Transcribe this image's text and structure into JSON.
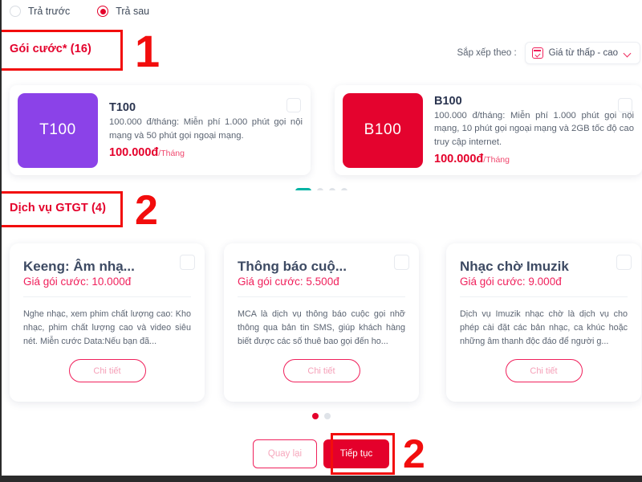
{
  "payment_type": {
    "options": [
      {
        "label": "Trả trước",
        "selected": false
      },
      {
        "label": "Trả sau",
        "selected": true
      }
    ]
  },
  "sections": {
    "plans_title": "Gói cước* (16)",
    "services_title": "Dịch vụ GTGT (4)"
  },
  "sort": {
    "label": "Sắp xếp theo :",
    "value": "Giá từ thấp - cao",
    "icon": "sort-price-icon",
    "chevron": "chevron-down-icon"
  },
  "plans": [
    {
      "tile_text": "T100",
      "tile_color": "#8b42e8",
      "name": "T100",
      "desc": "100.000 đ/tháng: Miễn phí 1.000 phút gọi nội mạng và 50 phút gọi ngoại mạng.",
      "price": "100.000đ",
      "period": "/Tháng"
    },
    {
      "tile_text": "B100",
      "tile_color": "#e4032e",
      "name": "B100",
      "desc": "100.000 đ/tháng: Miễn phí 1.000 phút gọi nội mạng, 10 phút gọi ngoại mạng và 2GB tốc độ cao truy cập internet.",
      "price": "100.000đ",
      "period": "/Tháng"
    }
  ],
  "plans_pagination": {
    "count": 4,
    "active": 0,
    "active_color": "#00b3a4"
  },
  "services": [
    {
      "title": "Keeng: Âm nhạ...",
      "price": "Giá gói cước: 10.000đ",
      "desc": "Nghe nhạc, xem phim chất lượng cao: Kho nhạc, phim chất lượng cao và video siêu nét. Miễn cước Data:Nếu bạn đã...",
      "button": "Chi tiết"
    },
    {
      "title": "Thông báo cuộ...",
      "price": "Giá gói cước: 5.500đ",
      "desc": "MCA là dịch vụ thông báo cuộc gọi nhỡ thông qua bản tin SMS, giúp khách hàng biết được các số thuê bao gọi đến ho...",
      "button": "Chi tiết"
    },
    {
      "title": "Nhạc chờ Imuzik",
      "price": "Giá gói cước: 9.000đ",
      "desc": "Dịch vụ Imuzik nhạc chờ là dịch vụ cho phép cài đặt các bản nhạc, ca khúc hoặc những âm thanh độc đáo để người g...",
      "button": "Chi tiết"
    }
  ],
  "services_pagination": {
    "count": 2,
    "active": 0,
    "active_color": "#e4002b"
  },
  "footer": {
    "back_label": "Quay lại",
    "next_label": "Tiếp tục"
  },
  "annotations": [
    {
      "number": "1",
      "target": "plans-section-title"
    },
    {
      "number": "2",
      "target": "services-section-title"
    },
    {
      "number": "2",
      "target": "next-button"
    }
  ],
  "colors": {
    "brand_red": "#e4002b",
    "pink": "#f0215c",
    "annotation_red": "#f20d0d",
    "teal": "#00b3a4",
    "title_navy": "#3d4a63"
  }
}
